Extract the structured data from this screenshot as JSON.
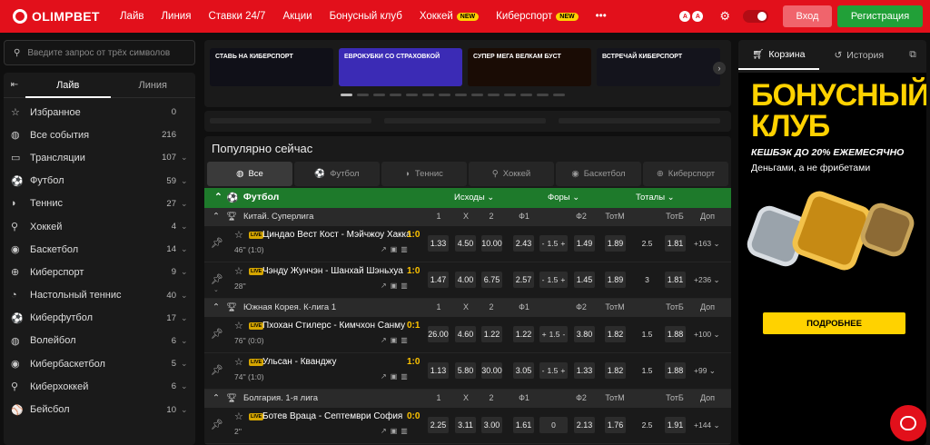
{
  "brand": {
    "name": "OLIMPBET"
  },
  "nav": [
    {
      "label": "Лайв"
    },
    {
      "label": "Линия"
    },
    {
      "label": "Ставки 24/7"
    },
    {
      "label": "Акции"
    },
    {
      "label": "Бонусный клуб"
    },
    {
      "label": "Хоккей",
      "badge": "NEW"
    },
    {
      "label": "Киберспорт",
      "badge": "NEW"
    },
    {
      "label": "•••"
    }
  ],
  "header": {
    "font_a": "A",
    "font_b": "A",
    "login": "Вход",
    "register": "Регистрация"
  },
  "search": {
    "placeholder": "Введите запрос от трёх символов"
  },
  "left_tabs": {
    "live": "Лайв",
    "line": "Линия"
  },
  "sports": [
    {
      "label": "Избранное",
      "count": "0",
      "icon": "☆"
    },
    {
      "label": "Все события",
      "count": "216",
      "icon": "◍"
    },
    {
      "label": "Трансляции",
      "count": "107",
      "icon": "▭"
    },
    {
      "label": "Футбол",
      "count": "59",
      "icon": "⚽"
    },
    {
      "label": "Теннис",
      "count": "27",
      "icon": "◗"
    },
    {
      "label": "Хоккей",
      "count": "4",
      "icon": "⚲"
    },
    {
      "label": "Баскетбол",
      "count": "14",
      "icon": "◉"
    },
    {
      "label": "Киберспорт",
      "count": "9",
      "icon": "⊕"
    },
    {
      "label": "Настольный теннис",
      "count": "40",
      "icon": "◔"
    },
    {
      "label": "Киберфутбол",
      "count": "17",
      "icon": "⚽"
    },
    {
      "label": "Волейбол",
      "count": "6",
      "icon": "◍"
    },
    {
      "label": "Кибербаскетбол",
      "count": "5",
      "icon": "◉"
    },
    {
      "label": "Киберхоккей",
      "count": "6",
      "icon": "⚲"
    },
    {
      "label": "Бейсбол",
      "count": "10",
      "icon": "⚾"
    }
  ],
  "banners": [
    {
      "title": "СТАВЬ НА КИБЕРСПОРТ",
      "color": "#101018"
    },
    {
      "title": "ЕВРОКУБКИ СО СТРАХОВКОЙ",
      "color": "#3b2bb5"
    },
    {
      "title": "СУПЕР МЕГА ВЕЛКАМ БУСТ",
      "color": "#1a0c05"
    },
    {
      "title": "ВСТРЕЧАЙ КИБЕРСПОРТ",
      "color": "#14141c"
    }
  ],
  "popular": {
    "title": "Популярно сейчас",
    "tabs": [
      {
        "label": "Все",
        "icon": "◍"
      },
      {
        "label": "Футбол",
        "icon": "⚽"
      },
      {
        "label": "Теннис",
        "icon": "◗"
      },
      {
        "label": "Хоккей",
        "icon": "⚲"
      },
      {
        "label": "Баскетбол",
        "icon": "◉"
      },
      {
        "label": "Киберспорт",
        "icon": "⊕"
      }
    ],
    "sport_header": {
      "sport": "Футбол",
      "outcomes": "Исходы",
      "handicaps": "Форы",
      "totals": "Тоталы"
    },
    "col_heads": [
      "1",
      "X",
      "2",
      "Ф1",
      "Ф2",
      "ТотМ",
      "ТотБ",
      "Доп"
    ],
    "leagues": [
      {
        "name": "Китай. Суперлига",
        "matches": [
          {
            "teams": "Циндао Вест Кост - Мэйчжоу Хакка",
            "score": "1:0",
            "time": "46'' (1:0)",
            "odds": [
              "1.33",
              "4.50",
              "10.00",
              "2.43"
            ],
            "hcap": [
              "-",
              "1.5",
              "+"
            ],
            "odds2": [
              "1.49",
              "1.89"
            ],
            "total": "2.5",
            "tb": "1.81",
            "more": "+163"
          },
          {
            "teams": "Чэнду Жунчэн - Шанхай Шэньхуа",
            "score": "1:0",
            "time": "28''",
            "odds": [
              "1.47",
              "4.00",
              "6.75",
              "2.57"
            ],
            "hcap": [
              "-",
              "1.5",
              "+"
            ],
            "odds2": [
              "1.45",
              "1.89"
            ],
            "total": "3",
            "tb": "1.81",
            "more": "+236"
          }
        ]
      },
      {
        "name": "Южная Корея. К-лига 1",
        "matches": [
          {
            "teams": "Пхохан Стилерс - Кимчхон Санму",
            "score": "0:1",
            "time": "76'' (0:0)",
            "odds": [
              "26.00",
              "4.60",
              "1.22",
              "1.22"
            ],
            "hcap": [
              "+",
              "1.5",
              "-"
            ],
            "odds2": [
              "3.80",
              "1.82"
            ],
            "total": "1.5",
            "tb": "1.88",
            "more": "+100"
          },
          {
            "teams": "Ульсан - Кванджу",
            "score": "1:0",
            "time": "74'' (1:0)",
            "odds": [
              "1.13",
              "5.80",
              "30.00",
              "3.05"
            ],
            "hcap": [
              "-",
              "1.5",
              "+"
            ],
            "odds2": [
              "1.33",
              "1.82"
            ],
            "total": "1.5",
            "tb": "1.88",
            "more": "+99"
          }
        ]
      },
      {
        "name": "Болгария. 1-я лига",
        "matches": [
          {
            "teams": "Ботев Враца - Септември София",
            "score": "0:0",
            "time": "2''",
            "odds": [
              "2.25",
              "3.11",
              "3.00",
              "1.61"
            ],
            "hcap": [
              "",
              "0",
              ""
            ],
            "odds2": [
              "2.13",
              "1.76"
            ],
            "total": "2.5",
            "tb": "1.91",
            "more": "+144"
          }
        ]
      }
    ]
  },
  "right": {
    "cart": "Корзина",
    "history": "История",
    "promo_title": "БОНУСНЫЙ КЛУБ",
    "cashback": "КЕШБЭК ДО 20% ЕЖЕМЕСЯЧНО",
    "promo_sub": "Деньгами, а не фрибетами",
    "promo_button": "ПОДРОБНЕЕ"
  }
}
